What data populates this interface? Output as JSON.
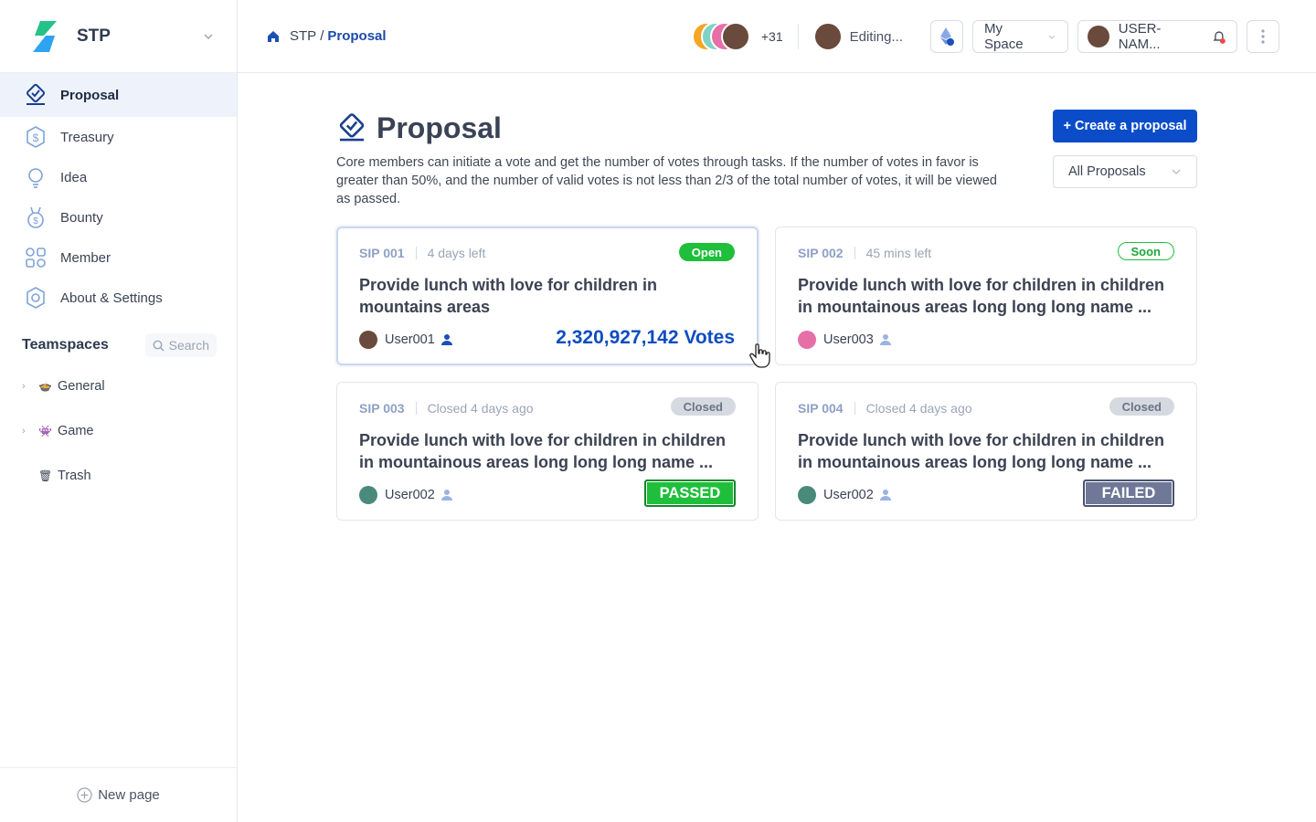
{
  "workspace": {
    "name": "STP"
  },
  "sidebar": {
    "items": [
      {
        "label": "Proposal",
        "icon": "proposal-icon",
        "active": true
      },
      {
        "label": "Treasury",
        "icon": "treasury-icon"
      },
      {
        "label": "Idea",
        "icon": "idea-icon"
      },
      {
        "label": "Bounty",
        "icon": "bounty-icon"
      },
      {
        "label": "Member",
        "icon": "member-icon"
      },
      {
        "label": "About & Settings",
        "icon": "settings-icon"
      }
    ],
    "teamspaces_title": "Teamspaces",
    "search_label": "Search",
    "teamspaces": [
      {
        "label": "General",
        "emoji": "🍲"
      },
      {
        "label": "Game",
        "emoji": "👾"
      },
      {
        "label": "Trash",
        "emoji": "🗑"
      }
    ],
    "new_page": "New page"
  },
  "topbar": {
    "breadcrumb_root": "STP",
    "breadcrumb_sep": "/",
    "breadcrumb_current": "Proposal",
    "extra_members": "+31",
    "editing": "Editing...",
    "space": "My Space",
    "user": "USER-NAM..."
  },
  "page": {
    "title": "Proposal",
    "create_button": "+ Create a proposal",
    "description": "Core members can initiate a vote and get the number of votes through tasks. If the number of votes in favor is greater than 50%, and the number of valid votes is not less than 2/3 of the total number of votes, it will be viewed as passed.",
    "filter": "All Proposals"
  },
  "proposals": [
    {
      "sip": "SIP 001",
      "time": "4 days left",
      "status": "Open",
      "title": "Provide lunch with love for children in mountains areas",
      "user": "User001",
      "votes": "2,320,927,142 Votes"
    },
    {
      "sip": "SIP 002",
      "time": "45 mins left",
      "status": "Soon",
      "title": "Provide lunch with love for children in children in mountainous areas long long long name ...",
      "user": "User003"
    },
    {
      "sip": "SIP 003",
      "time": "Closed 4 days ago",
      "status": "Closed",
      "title": "Provide lunch with love for children in children in mountainous areas long long long name ...",
      "user": "User002",
      "result": "PASSED"
    },
    {
      "sip": "SIP 004",
      "time": "Closed 4 days ago",
      "status": "Closed",
      "title": "Provide lunch with love for children in children in mountainous areas long long long name ...",
      "user": "User002",
      "result": "FAILED"
    }
  ],
  "colors": {
    "accent": "#0b4cc9",
    "open": "#1fbf3b",
    "failed": "#6f7896"
  }
}
